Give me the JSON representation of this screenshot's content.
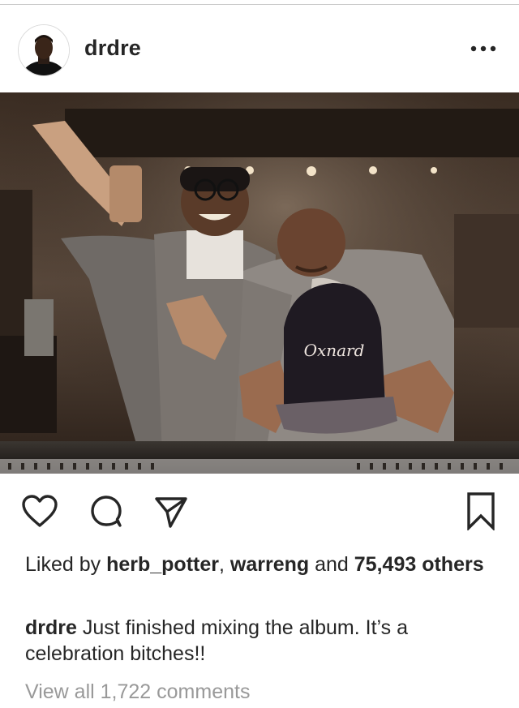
{
  "post": {
    "username": "drdre",
    "more_icon": "more-horizontal-icon",
    "actions": {
      "like_icon": "heart-icon",
      "comment_icon": "comment-icon",
      "share_icon": "send-icon",
      "save_icon": "bookmark-icon"
    },
    "likes": {
      "prefix": "Liked by",
      "user1": "herb_potter",
      "separator": ",",
      "user2": "warreng",
      "conjunction": "and",
      "count": "75,493",
      "suffix": "others"
    },
    "caption": {
      "author": "drdre",
      "text": "Just finished mixing the album. It’s a celebration bitches!!"
    },
    "view_comments": "View all 1,722 comments",
    "photo": {
      "cap_text": "Oxnard"
    }
  }
}
